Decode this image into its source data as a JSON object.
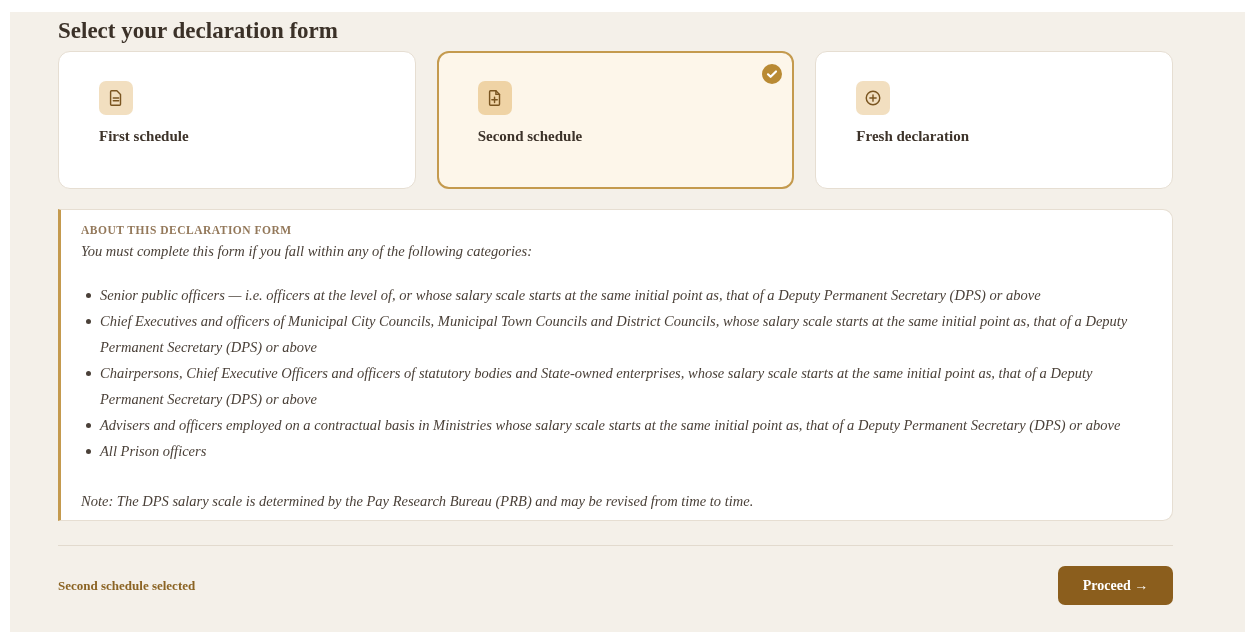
{
  "title": "Select your declaration form",
  "cards": [
    {
      "kind": "document",
      "label": "First schedule",
      "selected": false
    },
    {
      "kind": "document-add",
      "label": "Second schedule",
      "selected": true
    },
    {
      "kind": "circle-add",
      "label": "Fresh declaration",
      "selected": false
    }
  ],
  "info": {
    "heading": "ABOUT THIS DECLARATION FORM",
    "intro": "You must complete this form if you fall within any of the following categories:",
    "items": [
      "Senior public officers — i.e. officers at the level of, or whose salary scale starts at the same initial point as, that of a Deputy Permanent Secretary (DPS) or above",
      "Chief Executives and officers of Municipal City Councils, Municipal Town Councils and District Councils, whose salary scale starts at the same initial point as, that of a Deputy Permanent Secretary (DPS) or above",
      "Chairpersons, Chief Executive Officers and officers of statutory bodies and State-owned enterprises, whose salary scale starts at the same initial point as, that of a Deputy Permanent Secretary (DPS) or above",
      "Advisers and officers employed on a contractual basis in Ministries whose salary scale starts at the same initial point as, that of a Deputy Permanent Secretary (DPS) or above",
      "All Prison officers"
    ],
    "note": "Note: The DPS salary scale is determined by the Pay Research Bureau (PRB) and may be revised from time to time."
  },
  "footer": {
    "status": "Second schedule selected",
    "button": "Proceed →"
  }
}
